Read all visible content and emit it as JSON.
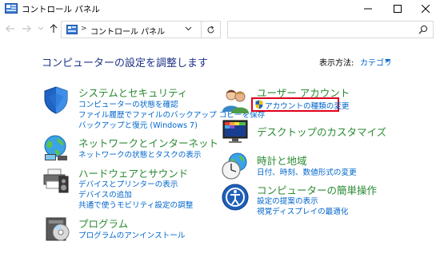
{
  "window": {
    "title": "コントロール パネル",
    "minimize_glyph": "—",
    "maximize_glyph": "☐",
    "close_glyph": "✕"
  },
  "address": {
    "breadcrumb": "コントロール パネル",
    "separator": ">",
    "search_placeholder": ""
  },
  "header": {
    "title": "コンピューターの設定を調整します",
    "view_by_label": "表示方法:",
    "view_by_value": "カテゴリ"
  },
  "categories": {
    "system": {
      "title": "システムとセキュリティ",
      "icon": "shield-icon",
      "links": [
        "コンピューターの状態を確認",
        "ファイル履歴でファイルのバックアップ コピーを保存",
        "バックアップと復元 (Windows 7)"
      ]
    },
    "network": {
      "title": "ネットワークとインターネット",
      "icon": "globe-network-icon",
      "links": [
        "ネットワークの状態とタスクの表示"
      ]
    },
    "hardware": {
      "title": "ハードウェアとサウンド",
      "icon": "printer-speaker-icon",
      "links": [
        "デバイスとプリンターの表示",
        "デバイスの追加",
        "共通で使うモビリティ設定の調整"
      ]
    },
    "programs": {
      "title": "プログラム",
      "icon": "programs-disc-icon",
      "links": [
        "プログラムのアンインストール"
      ]
    },
    "user": {
      "title": "ユーザー アカウント",
      "icon": "users-icon",
      "links": [
        "アカウントの種類の変更"
      ]
    },
    "appearance": {
      "title": "デスクトップのカスタマイズ",
      "icon": "display-palette-icon",
      "links": []
    },
    "clock": {
      "title": "時計と地域",
      "icon": "clock-globe-icon",
      "links": [
        "日付、時刻、数値形式の変更"
      ]
    },
    "ease": {
      "title": "コンピューターの簡単操作",
      "icon": "ease-of-access-icon",
      "links": [
        "設定の提案の表示",
        "視覚ディスプレイの最適化"
      ]
    }
  },
  "colors": {
    "heading": "#1e3287",
    "category_title": "#2a8a32",
    "link": "#0066cc",
    "highlight": "#e0001b"
  }
}
